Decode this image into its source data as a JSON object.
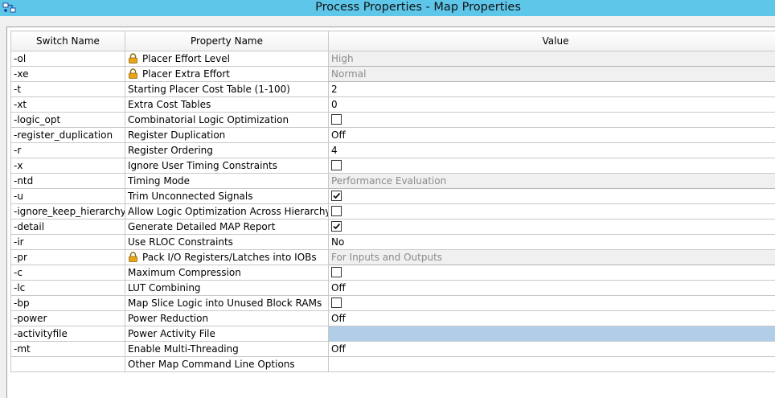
{
  "window": {
    "title": "Process Properties - Map Properties"
  },
  "columns": {
    "switch": "Switch Name",
    "property": "Property Name",
    "value": "Value"
  },
  "rows": [
    {
      "switch": "-ol",
      "property": "Placer Effort Level",
      "locked": true,
      "type": "text",
      "value": "High",
      "disabled": true
    },
    {
      "switch": "-xe",
      "property": "Placer Extra Effort",
      "locked": true,
      "type": "text",
      "value": "Normal",
      "disabled": true
    },
    {
      "switch": "-t",
      "property": "Starting Placer Cost Table (1-100)",
      "locked": false,
      "type": "text",
      "value": "2",
      "disabled": false
    },
    {
      "switch": "-xt",
      "property": "Extra Cost Tables",
      "locked": false,
      "type": "text",
      "value": "0",
      "disabled": false
    },
    {
      "switch": "-logic_opt",
      "property": "Combinatorial Logic Optimization",
      "locked": false,
      "type": "checkbox",
      "checked": false
    },
    {
      "switch": "-register_duplication",
      "property": "Register Duplication",
      "locked": false,
      "type": "text",
      "value": "Off",
      "disabled": false
    },
    {
      "switch": "-r",
      "property": "Register Ordering",
      "locked": false,
      "type": "text",
      "value": "4",
      "disabled": false
    },
    {
      "switch": "-x",
      "property": "Ignore User Timing Constraints",
      "locked": false,
      "type": "checkbox",
      "checked": false
    },
    {
      "switch": "-ntd",
      "property": "Timing Mode",
      "locked": false,
      "type": "text",
      "value": "Performance Evaluation",
      "disabled": true
    },
    {
      "switch": "-u",
      "property": "Trim Unconnected Signals",
      "locked": false,
      "type": "checkbox",
      "checked": true
    },
    {
      "switch": "-ignore_keep_hierarchy",
      "property": "Allow Logic Optimization Across Hierarchy",
      "locked": false,
      "type": "checkbox",
      "checked": false
    },
    {
      "switch": "-detail",
      "property": "Generate Detailed MAP Report",
      "locked": false,
      "type": "checkbox",
      "checked": true
    },
    {
      "switch": "-ir",
      "property": "Use RLOC Constraints",
      "locked": false,
      "type": "text",
      "value": "No",
      "disabled": false
    },
    {
      "switch": "-pr",
      "property": "Pack I/O Registers/Latches into IOBs",
      "locked": true,
      "type": "text",
      "value": "For Inputs and Outputs",
      "disabled": true
    },
    {
      "switch": "-c",
      "property": "Maximum Compression",
      "locked": false,
      "type": "checkbox",
      "checked": false
    },
    {
      "switch": "-lc",
      "property": "LUT Combining",
      "locked": false,
      "type": "text",
      "value": "Off",
      "disabled": false
    },
    {
      "switch": "-bp",
      "property": "Map Slice Logic into Unused Block RAMs",
      "locked": false,
      "type": "checkbox",
      "checked": false
    },
    {
      "switch": "-power",
      "property": "Power Reduction",
      "locked": false,
      "type": "text",
      "value": "Off",
      "disabled": false
    },
    {
      "switch": "-activityfile",
      "property": "Power Activity File",
      "locked": false,
      "type": "text",
      "value": "",
      "disabled": false,
      "selected": true
    },
    {
      "switch": "-mt",
      "property": "Enable Multi-Threading",
      "locked": false,
      "type": "text",
      "value": "Off",
      "disabled": false
    },
    {
      "switch": "",
      "property": "Other Map Command Line Options",
      "locked": false,
      "type": "text",
      "value": "",
      "disabled": false
    }
  ],
  "colors": {
    "titlebar": "#5ec6e9",
    "selected": "#b2cde8",
    "disabled_bg": "#f0f0f0",
    "lock": "#e8a317"
  },
  "icons": {
    "app": "process-properties-icon",
    "lock": "lock-icon",
    "check": "checkmark-icon"
  }
}
